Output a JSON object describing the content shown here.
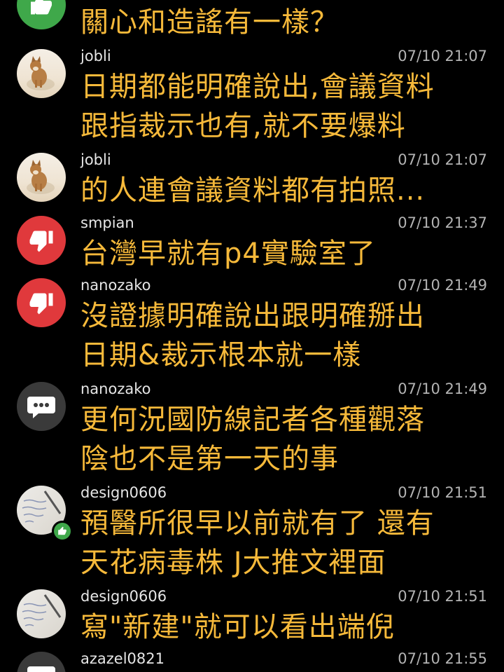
{
  "comments": [
    {
      "avatar_icon": "thumbs-up-icon",
      "username": "",
      "time": "",
      "lines": [
        "關心和造謠有一樣？"
      ]
    },
    {
      "avatar_icon": "cat-photo",
      "username": "jobli",
      "time": "07/10 21:07",
      "lines": [
        "日期都能明確說出,會議資料",
        "跟指裁示也有,就不要爆料"
      ]
    },
    {
      "avatar_icon": "cat-photo",
      "username": "jobli",
      "time": "07/10 21:07",
      "lines": [
        "的人連會議資料都有拍照..."
      ]
    },
    {
      "avatar_icon": "thumbs-down-icon",
      "username": "smpian",
      "time": "07/10 21:37",
      "lines": [
        "台灣早就有p4實驗室了"
      ]
    },
    {
      "avatar_icon": "thumbs-down-icon",
      "username": "nanozako",
      "time": "07/10 21:49",
      "lines": [
        "沒證據明確說出跟明確掰出",
        "日期&裁示根本就一樣"
      ]
    },
    {
      "avatar_icon": "chat-bubble-icon",
      "username": "nanozako",
      "time": "07/10 21:49",
      "lines": [
        "更何況國防線記者各種觀落",
        "陰也不是第一天的事"
      ]
    },
    {
      "avatar_icon": "paper-photo",
      "badge_icon": "thumbs-up-icon",
      "username": "design0606",
      "time": "07/10 21:51",
      "lines": [
        "預醫所很早以前就有了 還有",
        "天花病毒株 J大推文裡面"
      ]
    },
    {
      "avatar_icon": "paper-photo",
      "username": "design0606",
      "time": "07/10 21:51",
      "lines": [
        "寫\"新建\"就可以看出端倪"
      ]
    },
    {
      "avatar_icon": "chat-bubble-icon",
      "username": "azazel0821",
      "time": "07/10 21:55",
      "lines": []
    }
  ],
  "colors": {
    "background": "#000000",
    "content_text": "#f6b93a",
    "username_text": "#e6e6e6",
    "time_text": "#b3b3b3",
    "upvote": "#3fa84a",
    "downvote": "#e0393c",
    "neutral": "#3a3a3a"
  }
}
